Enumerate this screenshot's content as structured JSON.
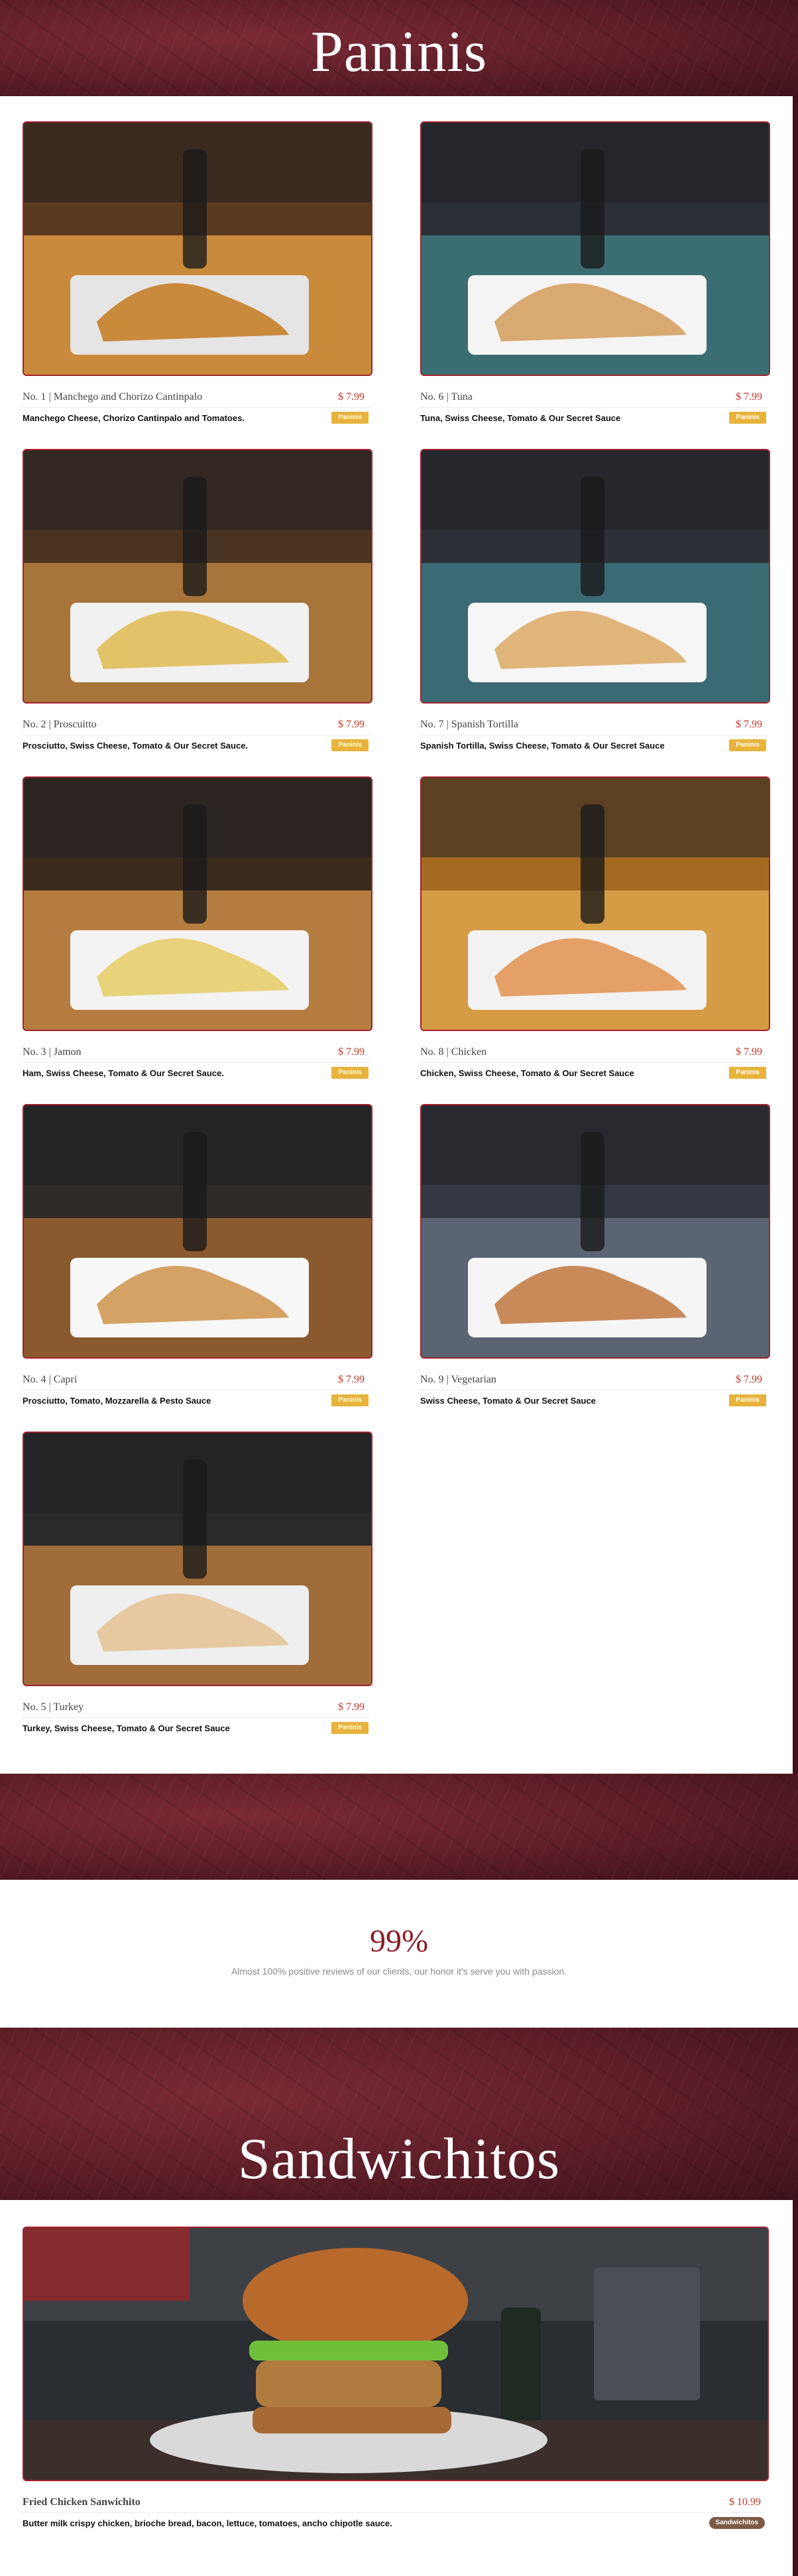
{
  "colors": {
    "accent": "#a3202e",
    "price": "#c0392b",
    "tag": "#e8b33b",
    "tag_brown": "#7d5a45",
    "band": "#5c1d27"
  },
  "paninis": {
    "title": "Paninis",
    "items": [
      {
        "num": "No. 1",
        "name": "Manchego and Chorizo Cantinpalo",
        "price": "$ 7.99",
        "desc": "Manchego Cheese, Chorizo Cantinpalo and Tomatoes.",
        "tag": "Paninis"
      },
      {
        "num": "No. 6",
        "name": "Tuna",
        "price": "$ 7.99",
        "desc": "Tuna, Swiss Cheese, Tomato & Our Secret Sauce",
        "tag": "Paninis"
      },
      {
        "num": "No. 2",
        "name": "Proscuitto",
        "price": "$ 7.99",
        "desc": "Prosciutto, Swiss Cheese, Tomato & Our Secret Sauce.",
        "tag": "Paninis"
      },
      {
        "num": "No. 7",
        "name": "Spanish Tortilla",
        "price": "$ 7.99",
        "desc": "Spanish Tortilla, Swiss Cheese, Tomato & Our Secret Sauce",
        "tag": "Paninis"
      },
      {
        "num": "No. 3",
        "name": "Jamon",
        "price": "$ 7.99",
        "desc": "Ham, Swiss Cheese, Tomato & Our Secret Sauce.",
        "tag": "Paninis"
      },
      {
        "num": "No. 8",
        "name": "Chicken",
        "price": "$ 7.99",
        "desc": "Chicken, Swiss Cheese, Tomato & Our Secret Sauce",
        "tag": "Paninis"
      },
      {
        "num": "No. 4",
        "name": "Capri",
        "price": "$ 7.99",
        "desc": "Prosciutto, Tomato, Mozzarella & Pesto Sauce",
        "tag": "Paninis"
      },
      {
        "num": "No. 9",
        "name": "Vegetarian",
        "price": "$ 7.99",
        "desc": "Swiss Cheese, Tomato & Our Secret Sauce",
        "tag": "Paninis"
      },
      {
        "num": "No. 5",
        "name": "Turkey",
        "price": "$ 7.99",
        "desc": "Turkey, Swiss Cheese, Tomato & Our Secret Sauce",
        "tag": "Paninis"
      }
    ]
  },
  "stats": {
    "value": "99%",
    "caption": "Almost 100% positive reviews of our clients, our honor it's serve you with passion."
  },
  "sandwichitos": {
    "title": "Sandwichitos",
    "items": [
      {
        "name": "Fried Chicken Sanwichito",
        "price": "$ 10.99",
        "desc": "Butter milk crispy chicken, brioche bread, bacon, lettuce, tomatoes, ancho chipotle sauce.",
        "tag": "Sandwichitos"
      }
    ]
  }
}
